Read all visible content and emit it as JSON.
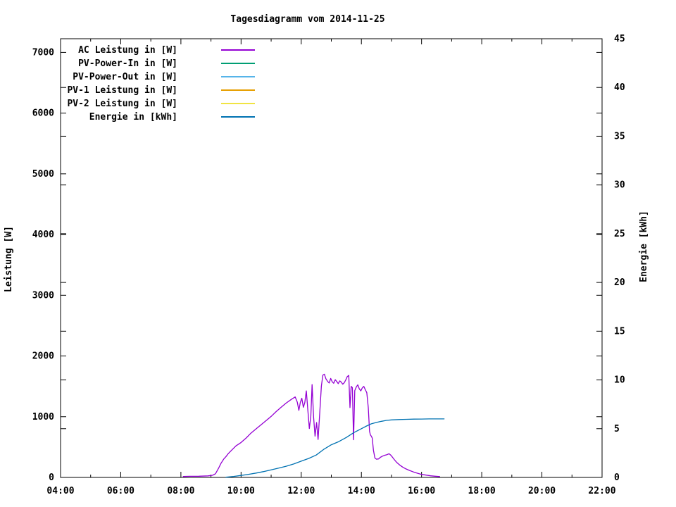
{
  "chart_data": {
    "type": "line",
    "title": "Tagesdiagramm vom 2014-11-25",
    "xlabel": "",
    "ylabel": "Leistung [W]",
    "y2label": "Energie [kWh]",
    "x_axis": {
      "tick_labels": [
        "04:00",
        "06:00",
        "08:00",
        "10:00",
        "12:00",
        "14:00",
        "16:00",
        "18:00",
        "20:00",
        "22:00"
      ],
      "labeled_hours": [
        4,
        6,
        8,
        10,
        12,
        14,
        16,
        18,
        20,
        22
      ],
      "range_hours": [
        4,
        22
      ],
      "minor_tick_every_hours": 1
    },
    "y_axis": {
      "label": "Leistung [W]",
      "ticks": [
        0,
        1000,
        2000,
        3000,
        4000,
        5000,
        6000,
        7000
      ],
      "range": [
        0,
        7225
      ]
    },
    "y2_axis": {
      "label": "Energie [kWh]",
      "ticks": [
        0,
        5,
        10,
        15,
        20,
        25,
        30,
        35,
        40,
        45
      ],
      "range": [
        0,
        45
      ]
    },
    "grid": false,
    "legend_position": "top-left-inside",
    "legend": [
      {
        "label": "AC Leistung in [W]",
        "color": "#9400d3"
      },
      {
        "label": "PV-Power-In in [W]",
        "color": "#009e73"
      },
      {
        "label": "PV-Power-Out in [W]",
        "color": "#56b4e9"
      },
      {
        "label": "PV-1 Leistung in [W]",
        "color": "#e69f00"
      },
      {
        "label": "PV-2 Leistung in [W]",
        "color": "#f0e442"
      },
      {
        "label": "Energie in [kWh]",
        "color": "#0072b2"
      }
    ],
    "series": [
      {
        "name": "AC Leistung in [W]",
        "axis": "y",
        "color": "#9400d3",
        "units": "W",
        "points": [
          [
            8.08,
            15
          ],
          [
            8.3,
            18
          ],
          [
            8.6,
            20
          ],
          [
            8.9,
            25
          ],
          [
            9.05,
            35
          ],
          [
            9.15,
            60
          ],
          [
            9.25,
            150
          ],
          [
            9.33,
            230
          ],
          [
            9.42,
            300
          ],
          [
            9.5,
            345
          ],
          [
            9.58,
            395
          ],
          [
            9.67,
            440
          ],
          [
            9.75,
            480
          ],
          [
            9.83,
            520
          ],
          [
            9.92,
            548
          ],
          [
            10.0,
            575
          ],
          [
            10.17,
            650
          ],
          [
            10.33,
            730
          ],
          [
            10.5,
            800
          ],
          [
            10.67,
            870
          ],
          [
            10.83,
            935
          ],
          [
            11.0,
            1005
          ],
          [
            11.17,
            1085
          ],
          [
            11.33,
            1155
          ],
          [
            11.5,
            1225
          ],
          [
            11.67,
            1285
          ],
          [
            11.8,
            1325
          ],
          [
            11.87,
            1240
          ],
          [
            11.92,
            1105
          ],
          [
            11.97,
            1235
          ],
          [
            12.02,
            1305
          ],
          [
            12.07,
            1155
          ],
          [
            12.12,
            1235
          ],
          [
            12.17,
            1425
          ],
          [
            12.22,
            1105
          ],
          [
            12.27,
            805
          ],
          [
            12.32,
            1005
          ],
          [
            12.36,
            1530
          ],
          [
            12.41,
            1000
          ],
          [
            12.46,
            680
          ],
          [
            12.51,
            905
          ],
          [
            12.56,
            625
          ],
          [
            12.62,
            1105
          ],
          [
            12.67,
            1505
          ],
          [
            12.72,
            1685
          ],
          [
            12.77,
            1700
          ],
          [
            12.82,
            1625
          ],
          [
            12.88,
            1580
          ],
          [
            12.93,
            1555
          ],
          [
            12.98,
            1630
          ],
          [
            13.03,
            1575
          ],
          [
            13.08,
            1550
          ],
          [
            13.13,
            1610
          ],
          [
            13.18,
            1580
          ],
          [
            13.23,
            1545
          ],
          [
            13.28,
            1590
          ],
          [
            13.33,
            1570
          ],
          [
            13.38,
            1535
          ],
          [
            13.43,
            1560
          ],
          [
            13.48,
            1605
          ],
          [
            13.53,
            1660
          ],
          [
            13.58,
            1680
          ],
          [
            13.62,
            1150
          ],
          [
            13.66,
            1500
          ],
          [
            13.7,
            1480
          ],
          [
            13.74,
            620
          ],
          [
            13.78,
            1430
          ],
          [
            13.83,
            1490
          ],
          [
            13.88,
            1525
          ],
          [
            13.93,
            1460
          ],
          [
            13.98,
            1425
          ],
          [
            14.03,
            1475
          ],
          [
            14.08,
            1500
          ],
          [
            14.13,
            1445
          ],
          [
            14.18,
            1395
          ],
          [
            14.23,
            1150
          ],
          [
            14.27,
            760
          ],
          [
            14.3,
            700
          ],
          [
            14.33,
            680
          ],
          [
            14.36,
            650
          ],
          [
            14.4,
            450
          ],
          [
            14.45,
            320
          ],
          [
            14.5,
            300
          ],
          [
            14.57,
            305
          ],
          [
            14.63,
            330
          ],
          [
            14.7,
            350
          ],
          [
            14.78,
            365
          ],
          [
            14.85,
            375
          ],
          [
            14.92,
            390
          ],
          [
            14.97,
            370
          ],
          [
            15.03,
            335
          ],
          [
            15.1,
            290
          ],
          [
            15.18,
            245
          ],
          [
            15.27,
            205
          ],
          [
            15.37,
            170
          ],
          [
            15.48,
            140
          ],
          [
            15.6,
            115
          ],
          [
            15.73,
            90
          ],
          [
            15.87,
            68
          ],
          [
            16.0,
            50
          ],
          [
            16.15,
            38
          ],
          [
            16.3,
            27
          ],
          [
            16.45,
            20
          ],
          [
            16.6,
            14
          ]
        ]
      },
      {
        "name": "Energie in [kWh]",
        "axis": "y2",
        "color": "#0072b2",
        "units": "kWh",
        "points": [
          [
            9.5,
            0.02
          ],
          [
            9.75,
            0.1
          ],
          [
            10.0,
            0.2
          ],
          [
            10.25,
            0.32
          ],
          [
            10.5,
            0.45
          ],
          [
            10.75,
            0.6
          ],
          [
            11.0,
            0.78
          ],
          [
            11.25,
            0.95
          ],
          [
            11.5,
            1.15
          ],
          [
            11.75,
            1.38
          ],
          [
            12.0,
            1.67
          ],
          [
            12.25,
            1.95
          ],
          [
            12.5,
            2.3
          ],
          [
            12.75,
            2.88
          ],
          [
            13.0,
            3.35
          ],
          [
            13.25,
            3.68
          ],
          [
            13.5,
            4.1
          ],
          [
            13.75,
            4.6
          ],
          [
            14.0,
            5.0
          ],
          [
            14.17,
            5.27
          ],
          [
            14.33,
            5.5
          ],
          [
            14.5,
            5.64
          ],
          [
            14.67,
            5.76
          ],
          [
            14.83,
            5.85
          ],
          [
            15.0,
            5.9
          ],
          [
            15.25,
            5.94
          ],
          [
            15.5,
            5.96
          ],
          [
            15.75,
            5.98
          ],
          [
            16.0,
            5.99
          ],
          [
            16.25,
            6.0
          ],
          [
            16.5,
            6.0
          ],
          [
            16.75,
            6.0
          ]
        ]
      }
    ]
  }
}
